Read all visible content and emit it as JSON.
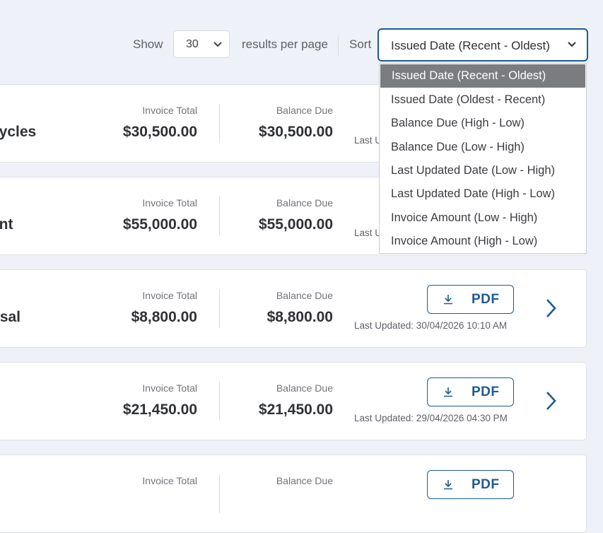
{
  "toolbar": {
    "show_label": "Show",
    "per_page_value": "30",
    "results_label": "results per page",
    "sort_label": "Sort",
    "sort_value": "Issued Date (Recent - Oldest)"
  },
  "sort_options": [
    "Issued Date (Recent - Oldest)",
    "Issued Date (Oldest - Recent)",
    "Balance Due (High - Low)",
    "Balance Due (Low - High)",
    "Last Updated Date (Low - High)",
    "Last Updated Date (High - Low)",
    "Invoice Amount (Low - High)",
    "Invoice Amount (High - Low)"
  ],
  "invoices": [
    {
      "name": "cycles",
      "invoice_total_label": "Invoice Total",
      "invoice_total": "$30,500.00",
      "balance_due_label": "Balance Due",
      "balance_due": "$30,500.00",
      "last_updated": "Last U"
    },
    {
      "name": "ent",
      "invoice_total_label": "Invoice Total",
      "invoice_total": "$55,000.00",
      "balance_due_label": "Balance Due",
      "balance_due": "$55,000.00",
      "last_updated": "Last U"
    },
    {
      "name": "osal",
      "invoice_total_label": "Invoice Total",
      "invoice_total": "$8,800.00",
      "balance_due_label": "Balance Due",
      "balance_due": "$8,800.00",
      "pdf_label": "PDF",
      "last_updated": "Last Updated: 30/04/2026 10:10 AM"
    },
    {
      "name": "",
      "invoice_total_label": "Invoice Total",
      "invoice_total": "$21,450.00",
      "balance_due_label": "Balance Due",
      "balance_due": "$21,450.00",
      "pdf_label": "PDF",
      "last_updated": "Last Updated: 29/04/2026 04:30 PM"
    },
    {
      "name": "",
      "invoice_total_label": "Invoice Total",
      "balance_due_label": "Balance Due",
      "pdf_label": "PDF"
    }
  ],
  "colors": {
    "accent": "#1f5a95",
    "selected_option_bg": "#7b7c80",
    "page_bg": "#eef1f8"
  },
  "icons": {
    "dropdown": "chevron-down-icon",
    "download": "download-icon",
    "row_action": "chevron-right-icon"
  }
}
